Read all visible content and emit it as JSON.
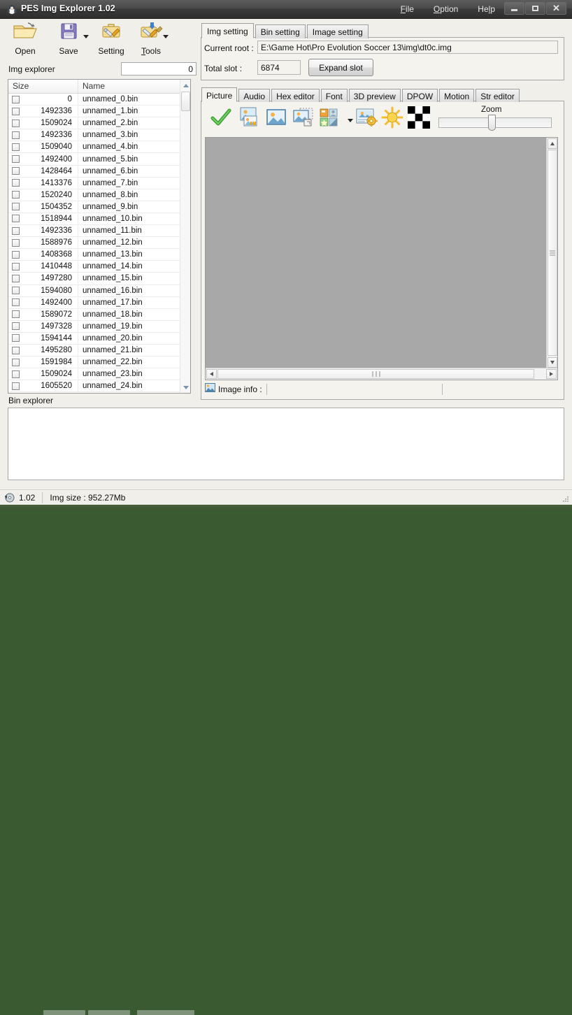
{
  "window": {
    "title": "PES Img Explorer 1.02",
    "app_icon": "penguin-icon",
    "menus": [
      {
        "label": "File",
        "accel": "F"
      },
      {
        "label": "Option",
        "accel": "O"
      },
      {
        "label": "Help",
        "accel": "l"
      }
    ],
    "controls": {
      "minimize": "minimize-icon",
      "maximize": "maximize-icon",
      "close": "close-icon"
    }
  },
  "ribbon": {
    "buttons": [
      {
        "label": "Open",
        "icon": "open-folder-icon",
        "has_dropdown": false
      },
      {
        "label": "Save",
        "icon": "floppy-save-icon",
        "has_dropdown": true
      },
      {
        "label": "Setting",
        "icon": "settings-toolbox-icon",
        "has_dropdown": false
      },
      {
        "label": "Tools",
        "icon": "tools-download-icon",
        "has_dropdown": true
      }
    ]
  },
  "img_explorer": {
    "label": "Img explorer",
    "count_value": "0",
    "columns": [
      "Size",
      "Name"
    ],
    "rows": [
      {
        "size": "0",
        "name": "unnamed_0.bin"
      },
      {
        "size": "1492336",
        "name": "unnamed_1.bin"
      },
      {
        "size": "1509024",
        "name": "unnamed_2.bin"
      },
      {
        "size": "1492336",
        "name": "unnamed_3.bin"
      },
      {
        "size": "1509040",
        "name": "unnamed_4.bin"
      },
      {
        "size": "1492400",
        "name": "unnamed_5.bin"
      },
      {
        "size": "1428464",
        "name": "unnamed_6.bin"
      },
      {
        "size": "1413376",
        "name": "unnamed_7.bin"
      },
      {
        "size": "1520240",
        "name": "unnamed_8.bin"
      },
      {
        "size": "1504352",
        "name": "unnamed_9.bin"
      },
      {
        "size": "1518944",
        "name": "unnamed_10.bin"
      },
      {
        "size": "1492336",
        "name": "unnamed_11.bin"
      },
      {
        "size": "1588976",
        "name": "unnamed_12.bin"
      },
      {
        "size": "1408368",
        "name": "unnamed_13.bin"
      },
      {
        "size": "1410448",
        "name": "unnamed_14.bin"
      },
      {
        "size": "1497280",
        "name": "unnamed_15.bin"
      },
      {
        "size": "1594080",
        "name": "unnamed_16.bin"
      },
      {
        "size": "1492400",
        "name": "unnamed_17.bin"
      },
      {
        "size": "1589072",
        "name": "unnamed_18.bin"
      },
      {
        "size": "1497328",
        "name": "unnamed_19.bin"
      },
      {
        "size": "1594144",
        "name": "unnamed_20.bin"
      },
      {
        "size": "1495280",
        "name": "unnamed_21.bin"
      },
      {
        "size": "1591984",
        "name": "unnamed_22.bin"
      },
      {
        "size": "1509024",
        "name": "unnamed_23.bin"
      },
      {
        "size": "1605520",
        "name": "unnamed_24.bin"
      }
    ]
  },
  "bin_explorer": {
    "label": "Bin explorer",
    "content": ""
  },
  "settings": {
    "tabs": [
      {
        "label": "Img setting",
        "active": true
      },
      {
        "label": "Bin setting",
        "active": false
      },
      {
        "label": "Image setting",
        "active": false
      }
    ],
    "current_root_label": "Current root :",
    "current_root_value": "E:\\Game Hot\\Pro Evolution Soccer 13\\img\\dt0c.img",
    "total_slot_label": "Total slot :",
    "total_slot_value": "6874",
    "expand_slot_label": "Expand slot"
  },
  "content": {
    "tabs": [
      {
        "label": "Picture",
        "active": true
      },
      {
        "label": "Audio",
        "active": false
      },
      {
        "label": "Hex editor",
        "active": false
      },
      {
        "label": "Font",
        "active": false
      },
      {
        "label": "3D preview",
        "active": false
      },
      {
        "label": "DPOW",
        "active": false
      },
      {
        "label": "Motion",
        "active": false
      },
      {
        "label": "Str editor",
        "active": false
      }
    ],
    "picture_toolbar": [
      {
        "icon": "green-check-icon",
        "has_dropdown": false
      },
      {
        "icon": "image-import-icon",
        "has_dropdown": false
      },
      {
        "icon": "image-view-icon",
        "has_dropdown": false
      },
      {
        "icon": "image-copy-icon",
        "has_dropdown": false
      },
      {
        "icon": "image-palette-icon",
        "has_dropdown": true
      },
      {
        "icon": "image-properties-icon",
        "has_dropdown": false
      },
      {
        "icon": "brightness-sun-icon",
        "has_dropdown": false
      },
      {
        "icon": "checkerboard-alpha-icon",
        "has_dropdown": false
      }
    ],
    "zoom_label": "Zoom",
    "zoom_value": "50",
    "preview_background": "#a8a8a8",
    "image_info_label": "Image info :",
    "image_info_icon": "picture-icon",
    "image_info_value": ""
  },
  "statusbar": {
    "version_icon": "disc-icon",
    "version": "1.02",
    "img_size_text": "Img size : 952.27Mb"
  },
  "colors": {
    "titlebar_dark": "#3a3a3a",
    "window_bg": "#f0efe9",
    "panel_bg": "#f4f3ee",
    "preview_gray": "#a8a8a8",
    "accent_green": "#3fa532",
    "desktop_green": "#47603a"
  }
}
